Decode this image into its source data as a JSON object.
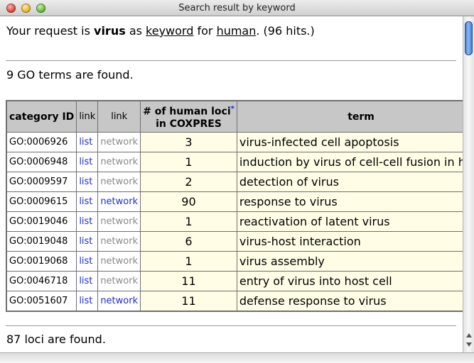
{
  "window": {
    "title": "Search result by keyword"
  },
  "request": {
    "prefix": "Your request is ",
    "keyword_value": "virus",
    "as_text": " as ",
    "field_link": "keyword",
    "for_text": " for ",
    "species_link": "human",
    "suffix": ". (96 hits.)"
  },
  "go_summary": "9 GO terms are found.",
  "table": {
    "headers": {
      "category_id": "category ID",
      "link1": "link",
      "link2": "link",
      "loci_line1": "# of human loci",
      "loci_star": "*",
      "loci_line2": "in COXPRES",
      "term": "term"
    },
    "rows": [
      {
        "id": "GO:0006926",
        "list": "list",
        "network": "network",
        "network_active": false,
        "loci": "3",
        "term": "virus-infected cell apoptosis"
      },
      {
        "id": "GO:0006948",
        "list": "list",
        "network": "network",
        "network_active": false,
        "loci": "1",
        "term": "induction by virus of cell-cell fusion in host"
      },
      {
        "id": "GO:0009597",
        "list": "list",
        "network": "network",
        "network_active": false,
        "loci": "2",
        "term": "detection of virus"
      },
      {
        "id": "GO:0009615",
        "list": "list",
        "network": "network",
        "network_active": true,
        "loci": "90",
        "term": "response to virus"
      },
      {
        "id": "GO:0019046",
        "list": "list",
        "network": "network",
        "network_active": false,
        "loci": "1",
        "term": "reactivation of latent virus"
      },
      {
        "id": "GO:0019048",
        "list": "list",
        "network": "network",
        "network_active": false,
        "loci": "6",
        "term": "virus-host interaction"
      },
      {
        "id": "GO:0019068",
        "list": "list",
        "network": "network",
        "network_active": false,
        "loci": "1",
        "term": "virus assembly"
      },
      {
        "id": "GO:0046718",
        "list": "list",
        "network": "network",
        "network_active": false,
        "loci": "11",
        "term": "entry of virus into host cell"
      },
      {
        "id": "GO:0051607",
        "list": "list",
        "network": "network",
        "network_active": true,
        "loci": "11",
        "term": "defense response to virus"
      }
    ]
  },
  "loci_summary": "87 loci are found.",
  "colors": {
    "link": "#1b2bd6",
    "dim_link": "#888888",
    "header_bg": "#c7c7c7",
    "cell_bg": "#fffde6"
  }
}
